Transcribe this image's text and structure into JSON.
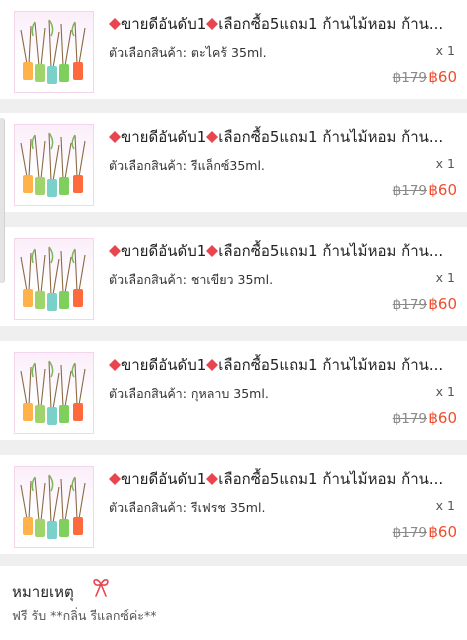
{
  "orders": [
    {
      "title": "ขายดีอันดับ1",
      "title_rest": "เลือกซื้อ5แถม1 ก้านไม้หอม ก้าน...",
      "variant": "ตัวเลือกสินค้า: ตะไคร้ 35ml.",
      "qty": "x 1",
      "old_price": "฿179",
      "new_price": "฿60"
    },
    {
      "title": "ขายดีอันดับ1",
      "title_rest": "เลือกซื้อ5แถม1 ก้านไม้หอม ก้าน...",
      "variant": "ตัวเลือกสินค้า: รีแล็กซ์35ml.",
      "qty": "x 1",
      "old_price": "฿179",
      "new_price": "฿60"
    },
    {
      "title": "ขายดีอันดับ1",
      "title_rest": "เลือกซื้อ5แถม1 ก้านไม้หอม ก้าน...",
      "variant": "ตัวเลือกสินค้า: ชาเขียว 35ml.",
      "qty": "x 1",
      "old_price": "฿179",
      "new_price": "฿60"
    },
    {
      "title": "ขายดีอันดับ1",
      "title_rest": "เลือกซื้อ5แถม1 ก้านไม้หอม ก้าน...",
      "variant": "ตัวเลือกสินค้า: กุหลาบ 35ml.",
      "qty": "x 1",
      "old_price": "฿179",
      "new_price": "฿60"
    },
    {
      "title": "ขายดีอันดับ1",
      "title_rest": "เลือกซื้อ5แถม1 ก้านไม้หอม ก้าน...",
      "variant": "ตัวเลือกสินค้า: รีเฟรช 35ml.",
      "qty": "x 1",
      "old_price": "฿179",
      "new_price": "฿60"
    }
  ],
  "notes": {
    "label": "หมายเหตุ",
    "icon": "ribbon-bow-icon",
    "text": "ฟรี รับ **กลิ่น รีแลกซ์ค่ะ**"
  },
  "colors": {
    "price": "#ee4d2d",
    "gem": "#e8454e",
    "background": "#efefef"
  }
}
